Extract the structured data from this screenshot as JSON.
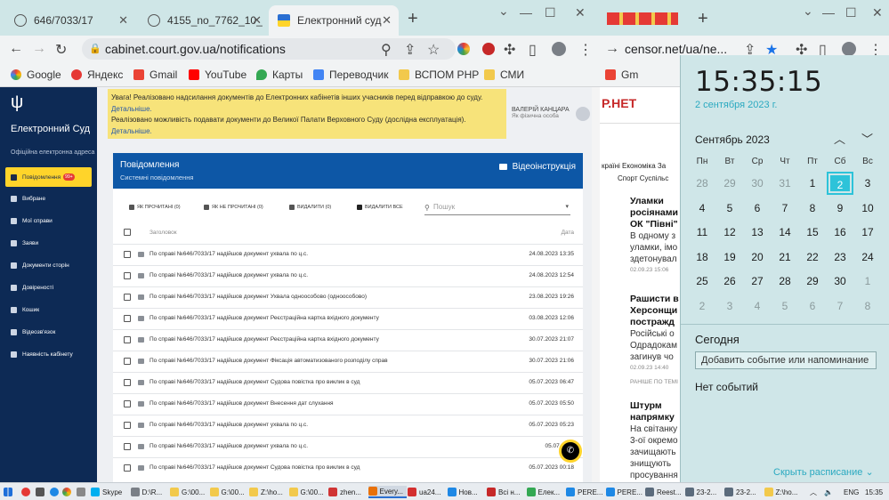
{
  "browser1": {
    "tabs": [
      {
        "label": "646/7033/17",
        "active": false
      },
      {
        "label": "4155_no_7762_10_",
        "active": false
      },
      {
        "label": "Електронний суд",
        "active": true
      }
    ],
    "url": "cabinet.court.gov.ua/notifications",
    "bookmarks": [
      "Google",
      "Яндекс",
      "Gmail",
      "YouTube",
      "Карты",
      "Переводчик",
      "ВСПОМ РНР",
      "СМИ"
    ]
  },
  "sidebar": {
    "title": "Електронний Суд",
    "subtitle": "Офіційна електронна адреса",
    "items": [
      {
        "label": "Повідомлення",
        "badge": "99+"
      },
      {
        "label": "Вибране"
      },
      {
        "label": "Мої справи"
      },
      {
        "label": "Заяви"
      },
      {
        "label": "Документи сторін"
      },
      {
        "label": "Довіреності"
      },
      {
        "label": "Кошик"
      },
      {
        "label": "Відеозв'язок"
      },
      {
        "label": "Наявність кабінету"
      }
    ]
  },
  "alert": {
    "line1": "Увага! Реалізовано надсилання документів до Електронних кабінетів інших учасників перед відправкою до суду.",
    "link1": "Детальніше.",
    "line2": "Реалізовано можливість подавати документи до Великої Палати Верховного Суду (дослідна експлуатація).",
    "link2": "Детальніше."
  },
  "user": {
    "name": "ВАЛЕРІЙ КАНЦАРА",
    "role": "Як фізична особа"
  },
  "panel": {
    "title": "Повідомлення",
    "subtitle": "Системні повідомлення",
    "video": "Відеоінструкція",
    "toolbar": {
      "read": "ЯК ПРОЧИТАНІ (0)",
      "unread": "ЯК НЕ ПРОЧИТАНІ (0)",
      "delete": "ВИДАЛИТИ (0)",
      "delete_all": "ВИДАЛИТИ ВСЕ",
      "search_placeholder": "Пошук"
    },
    "col_title": "Заголовок",
    "col_date": "Дата",
    "rows": [
      {
        "text": "По справі №646/7033/17 надійшов документ ухвала по ц.с.",
        "date": "24.08.2023 13:35"
      },
      {
        "text": "По справі №646/7033/17 надійшов документ ухвала по ц.с.",
        "date": "24.08.2023 12:54"
      },
      {
        "text": "По справі №646/7033/17 надійшов документ Ухвала одноособово (одноособово)",
        "date": "23.08.2023 19:26"
      },
      {
        "text": "По справі №646/7033/17 надійшов документ Реєстраційна картка вхідного документу",
        "date": "03.08.2023 12:06"
      },
      {
        "text": "По справі №646/7033/17 надійшов документ Реєстраційна картка вхідного документу",
        "date": "30.07.2023 21:07"
      },
      {
        "text": "По справі №646/7033/17 надійшов документ Фіксація автоматизованого розподілу справ",
        "date": "30.07.2023 21:06"
      },
      {
        "text": "По справі №646/7033/17 надійшов документ Судова повістка про виклик в суд",
        "date": "05.07.2023 06:47"
      },
      {
        "text": "По справі №646/7033/17 надійшов документ Внесення дат слухання",
        "date": "05.07.2023 05:50"
      },
      {
        "text": "По справі №646/7033/17 надійшов документ ухвала по ц.с.",
        "date": "05.07.2023 05:23"
      },
      {
        "text": "По справі №646/7033/17 надійшов документ ухвала по ц.с.",
        "date": "05.07.2023"
      },
      {
        "text": "По справі №646/7033/17 надійшов документ Судова повістка про виклик в суд",
        "date": "05.07.2023 00:18"
      }
    ]
  },
  "browser2": {
    "url": "censor.net/ua/ne...",
    "bookmark": "Gm",
    "logo": "Р.НЕТ",
    "nav1": "країні  Економіка  За",
    "nav2": "Спорт  Суспільс",
    "news": [
      {
        "title": "Уламки росіянами ОК \"Півні\"",
        "body": "В одному з уламки, імо здетонувал",
        "time": "02.09.23 15:06"
      },
      {
        "title": "Рашисти в Херсонщи постражд",
        "body": "Російські о Одрадокам загинув чо",
        "time": "02.09.23 14:40"
      },
      {
        "title": "Штурм напрямку",
        "body": "На світанку 3-ої окремо зачищають знищують просування",
        "time": ""
      }
    ],
    "earlier": "РАНІШЕ ПО ТЕМІ"
  },
  "calendar": {
    "time": "15:35:15",
    "date": "2 сентября 2023 г.",
    "month": "Сентябрь 2023",
    "weekdays": [
      "Пн",
      "Вт",
      "Ср",
      "Чт",
      "Пт",
      "Сб",
      "Вс"
    ],
    "days": [
      "28",
      "29",
      "30",
      "31",
      "1",
      "2",
      "3",
      "4",
      "5",
      "6",
      "7",
      "8",
      "9",
      "10",
      "11",
      "12",
      "13",
      "14",
      "15",
      "16",
      "17",
      "18",
      "19",
      "20",
      "21",
      "22",
      "23",
      "24",
      "25",
      "26",
      "27",
      "28",
      "29",
      "30",
      "1",
      "2",
      "3",
      "4",
      "5",
      "6",
      "7",
      "8"
    ],
    "today_index": 5,
    "today_label": "Сегодня",
    "add_event": "Добавить событие или напоминание",
    "no_events": "Нет событий",
    "schedule": "Скрыть расписание"
  },
  "taskbar": {
    "items": [
      "Skype",
      "D:\\R...",
      "G:\\00...",
      "G:\\00...",
      "Z:\\ho...",
      "G:\\00...",
      "zhen...",
      "Every...",
      "ua24...",
      "Нов...",
      "Всі н...",
      "Елек...",
      "PERE...",
      "PERE...",
      "Reest...",
      "23-2...",
      "23-2...",
      "Z:\\ho..."
    ],
    "lang": "ENG",
    "time": "15:35"
  }
}
